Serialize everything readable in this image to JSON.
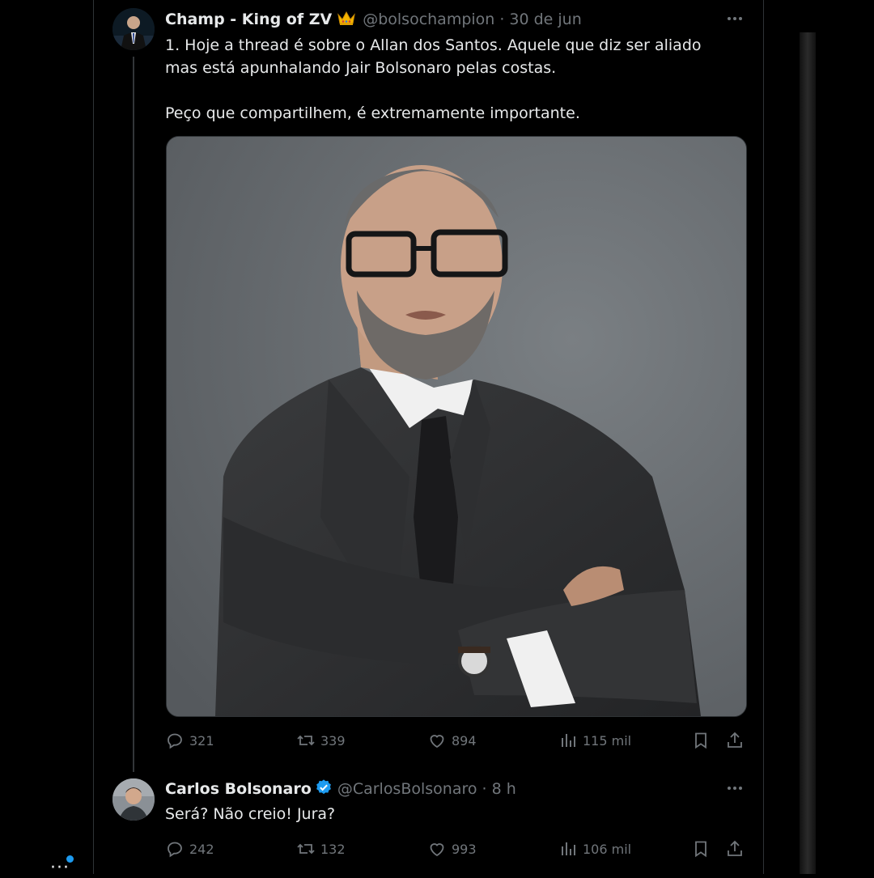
{
  "tweet": {
    "author_name": "Champ - King of ZV",
    "author_badge_icon": "crown-icon",
    "author_handle": "@bolsochampion",
    "separator": "·",
    "timestamp": "30 de jun",
    "text_line1": "1. Hoje a thread é sobre o Allan dos Santos. Aquele que diz ser aliado mas está apunhalando Jair Bolsonaro pelas costas.",
    "text_line2": "Peço que compartilhem, é extremamente importante.",
    "media_icon": "portrait-photo",
    "stats": {
      "replies": "321",
      "retweets": "339",
      "likes": "894",
      "views": "115 mil"
    }
  },
  "reply": {
    "author_name": "Carlos Bolsonaro",
    "verified_icon": "verified-badge-icon",
    "author_handle": "@CarlosBolsonaro",
    "separator": "·",
    "timestamp": "8 h",
    "text": "Será? Não creio! Jura?",
    "stats": {
      "replies": "242",
      "retweets": "132",
      "likes": "993",
      "views": "106 mil"
    }
  },
  "colors": {
    "background": "#000000",
    "text_primary": "#e7e9ea",
    "text_secondary": "#71767b",
    "accent_blue": "#1d9bf0",
    "crown": "#f4b400"
  }
}
